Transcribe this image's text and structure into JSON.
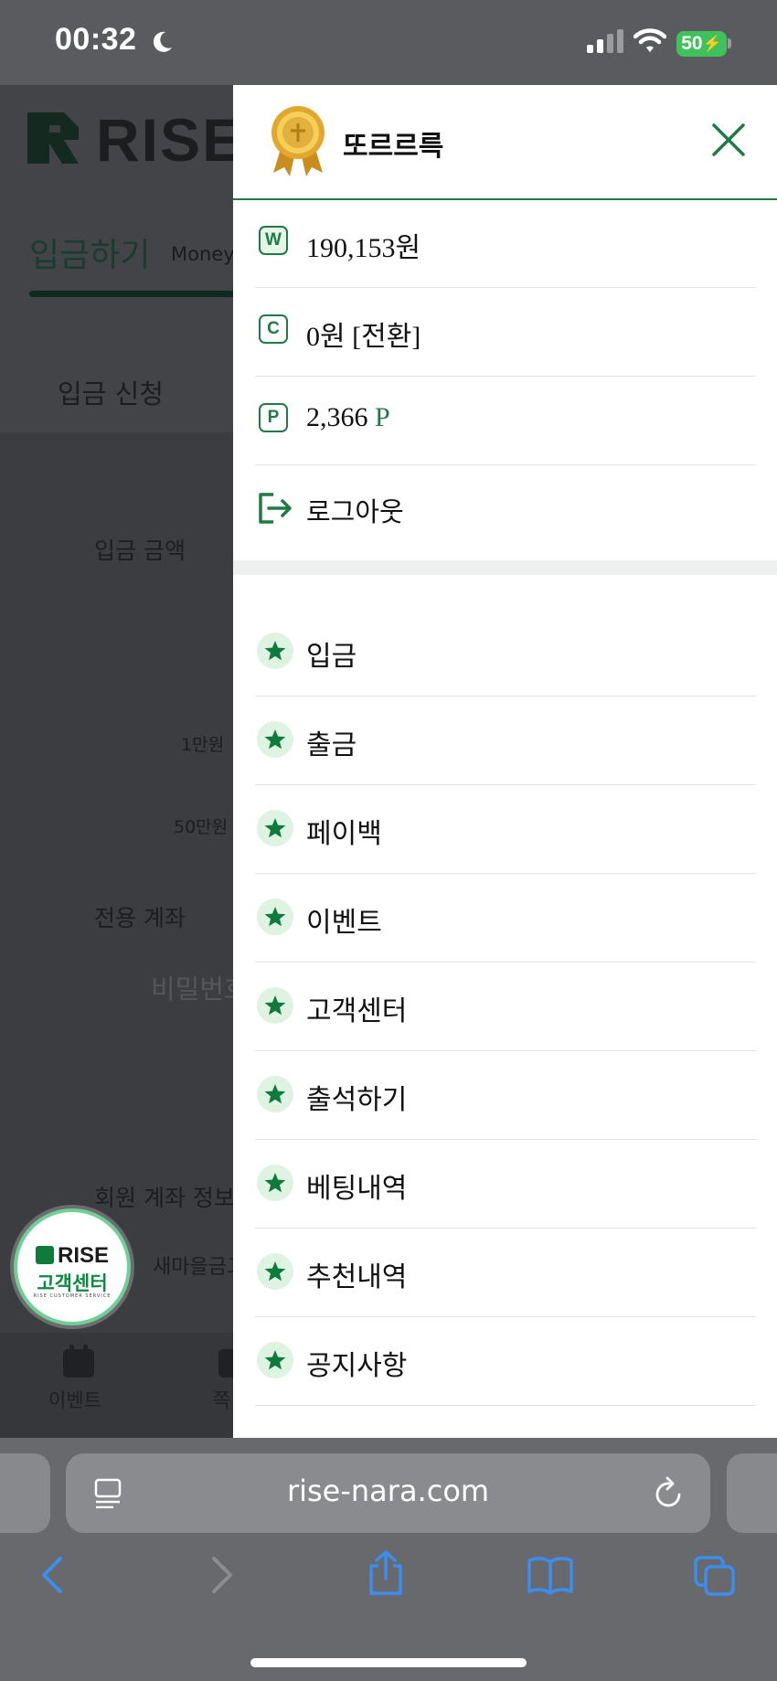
{
  "status_bar": {
    "time": "00:32",
    "battery": "50"
  },
  "background": {
    "logo_text": "RISE",
    "tab_title": "입금하기",
    "tab_subtitle": "Money",
    "section_title": "입금 신청",
    "amount_label": "입금 금액",
    "chip_1": "1만원",
    "chip_2": "50만원",
    "account_label": "전용 계좌",
    "password_placeholder": "비밀번호",
    "member_account_label": "회원 계좌 정보",
    "bank_name": "새마을금고",
    "nav_event": "이벤트",
    "nav_second": "쪽"
  },
  "cs_badge": {
    "brand": "RISE",
    "label": "고객센터",
    "sub": "RISE CUSTOMER SERVICE"
  },
  "drawer": {
    "username": "또르르륵",
    "wallet": [
      {
        "icon": "W",
        "text": "190,153원"
      },
      {
        "icon": "C",
        "text": "0원 [전환]"
      },
      {
        "icon": "P",
        "text": "2,366",
        "unit": "P"
      }
    ],
    "logout": "로그아웃",
    "menu": [
      "입금",
      "출금",
      "페이백",
      "이벤트",
      "고객센터",
      "출석하기",
      "베팅내역",
      "추천내역",
      "공지사항"
    ]
  },
  "browser": {
    "url": "rise-nara.com"
  },
  "colors": {
    "accent": "#1f7a44",
    "star": "#0e7a3c"
  },
  "icons": [
    "moon-icon",
    "signal-icon",
    "wifi-icon",
    "medal-icon",
    "close-icon",
    "logout-icon",
    "star-icon",
    "reader-icon",
    "reload-icon",
    "back-icon",
    "forward-icon",
    "share-icon",
    "bookmarks-icon",
    "tabs-icon"
  ]
}
